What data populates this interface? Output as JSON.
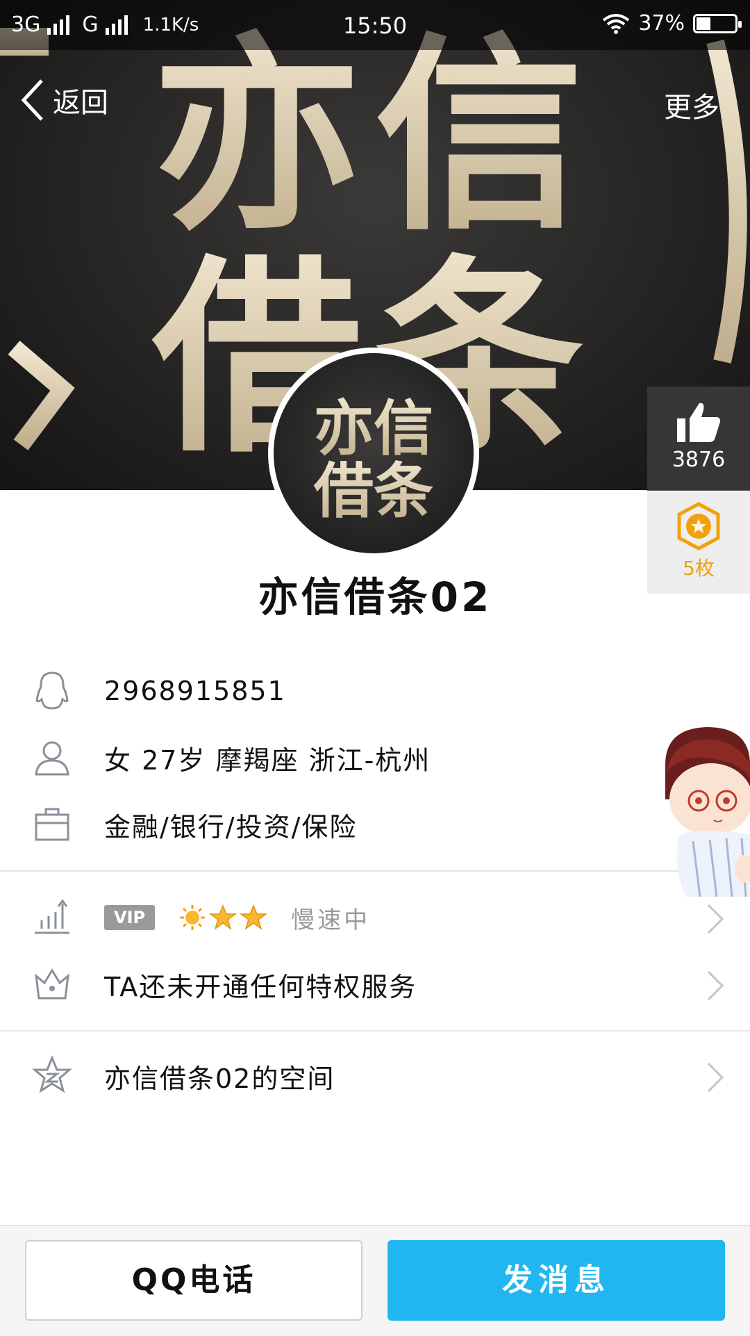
{
  "status_bar": {
    "network_1": "3G",
    "network_2": "G",
    "speed": "1.1K/s",
    "time": "15:50",
    "battery": "37%",
    "battery_level": 0.37
  },
  "nav": {
    "back_label": "返回",
    "more_label": "更多"
  },
  "banner": {
    "logo_line1": "亦信",
    "logo_line2": "借条"
  },
  "likes": {
    "count": "3876"
  },
  "badges": {
    "count": "5枚"
  },
  "profile": {
    "nickname": "亦信借条02",
    "qq_number": "2968915851",
    "personal": "女  27岁  摩羯座  浙江-杭州",
    "occupation": "金融/银行/投资/保险"
  },
  "vip": {
    "tag": "VIP",
    "status": "慢速中"
  },
  "privilege": {
    "text": "TA还未开通任何特权服务"
  },
  "space": {
    "text": "亦信借条02的空间"
  },
  "actions": {
    "call_label": "QQ电话",
    "message_label": "发消息"
  },
  "colors": {
    "accent": "#21b6f0",
    "badge_gold": "#f1a10c",
    "banner_text": "#e8dcc4"
  }
}
